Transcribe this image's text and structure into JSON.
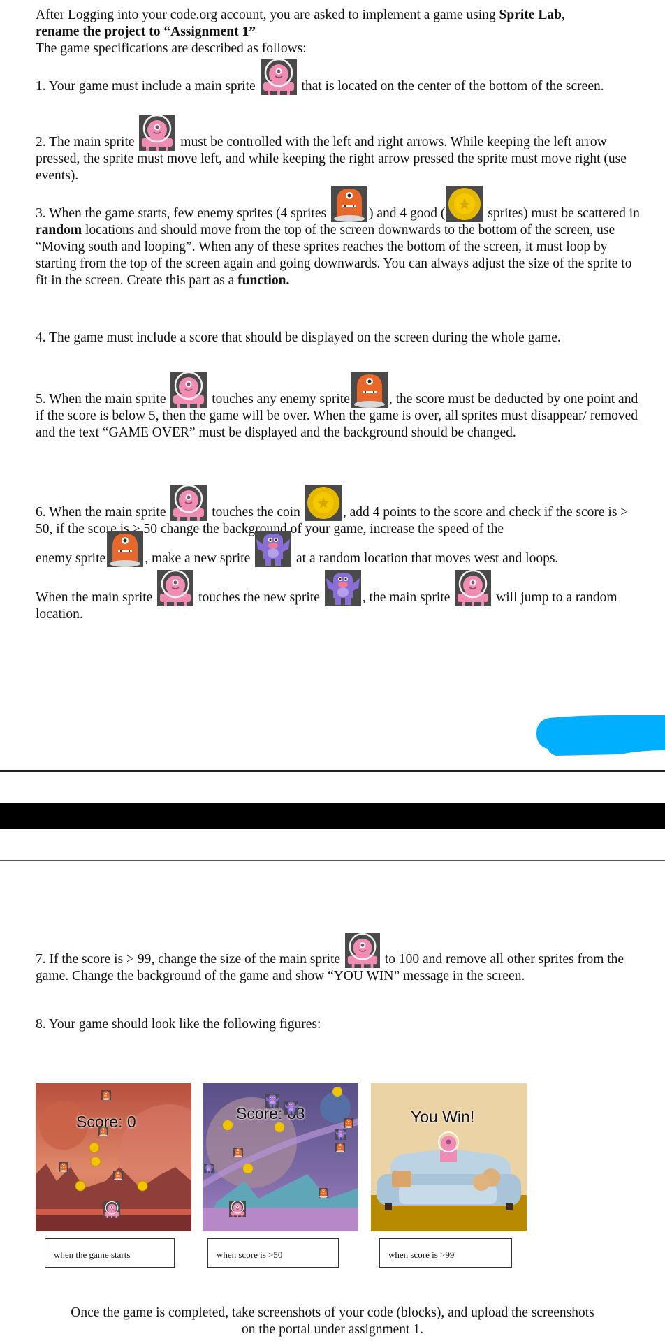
{
  "intro": {
    "line1_pre": "After Logging into your code.org account, you are asked to implement a game using ",
    "line1_bold": "Sprite Lab,",
    "line2_bold": "rename the project to “Assignment 1”",
    "line3": "The game specifications are described as follows:"
  },
  "items": {
    "i1": {
      "a": "1. Your game must include a main sprite ",
      "b": " that is located on the center of the bottom of the screen."
    },
    "i2": {
      "a": "2. The main sprite ",
      "b": " must be controlled with the left and right arrows. While keeping the left arrow pressed, the sprite must move left, and while keeping the right arrow pressed the sprite must move right (use events)."
    },
    "i3": {
      "a": "3. When the game starts, few enemy sprites (4 sprites ",
      "b": ") and 4 good (",
      "c": " sprites) must be scattered in ",
      "bold1": "random",
      "d": " locations and should move from the top of the screen downwards to the bottom of the screen, use “Moving south and looping”. When any of these sprites reaches the bottom of the screen, it must loop by starting from the top of the screen again and going downwards. You can always adjust the size of the sprite to fit in the screen. Create this part as a ",
      "bold2": "function."
    },
    "i4": {
      "a": "4. The game must include a score that should be displayed on the screen during the whole game."
    },
    "i5": {
      "a": "5. When the main sprite ",
      "b": " touches any enemy sprite",
      "c": ", the score must be deducted by one point and if the score is below 5, then the game will be over. When the game is over, all sprites must disappear/ removed and the text “GAME OVER” must be displayed and the background should be changed."
    },
    "i6": {
      "a": "6. When the main sprite ",
      "b": " touches the coin ",
      "c": ", add 4 points to the score and check if the score is > 50, if the score is > 50 change the background of your game, increase the speed of the",
      "d": "enemy sprite",
      "e": ", make a new sprite ",
      "f": " at a random location that moves west and loops."
    },
    "i6b": {
      "a": "When the main sprite ",
      "b": " touches the new sprite ",
      "c": ", the main sprite ",
      "d": " will jump to a random location."
    },
    "i7": {
      "a": "7. If the score is > 99, change the size of the main sprite ",
      "b": " to 100 and remove all other sprites from the game. Change the background of the game and show “YOU WIN” message in the screen."
    },
    "i8": {
      "a": "8. Your game should look like the following figures:"
    }
  },
  "sprites": {
    "main": "pink-astronaut-sprite",
    "enemy": "orange-monster-sprite",
    "coin": "gold-coin-sprite",
    "new": "purple-monster-sprite"
  },
  "figures": [
    {
      "score_text": "Score: 0",
      "caption": "when the game starts"
    },
    {
      "score_text": "Score: 63",
      "caption": "when score is >50"
    },
    {
      "score_text": "You Win!",
      "caption": "when score is >99"
    }
  ],
  "footer": {
    "line1": "Once the game is completed, take screenshots of your code (blocks), and upload the screenshots",
    "line2": "on the portal under assignment 1."
  },
  "colors": {
    "redaction": "#00b0ff",
    "sprite_bg": "#4a4a4a",
    "pink": "#f08cb4",
    "orange": "#e8672a",
    "coin": "#e6b800",
    "purple": "#8a6ed8"
  }
}
